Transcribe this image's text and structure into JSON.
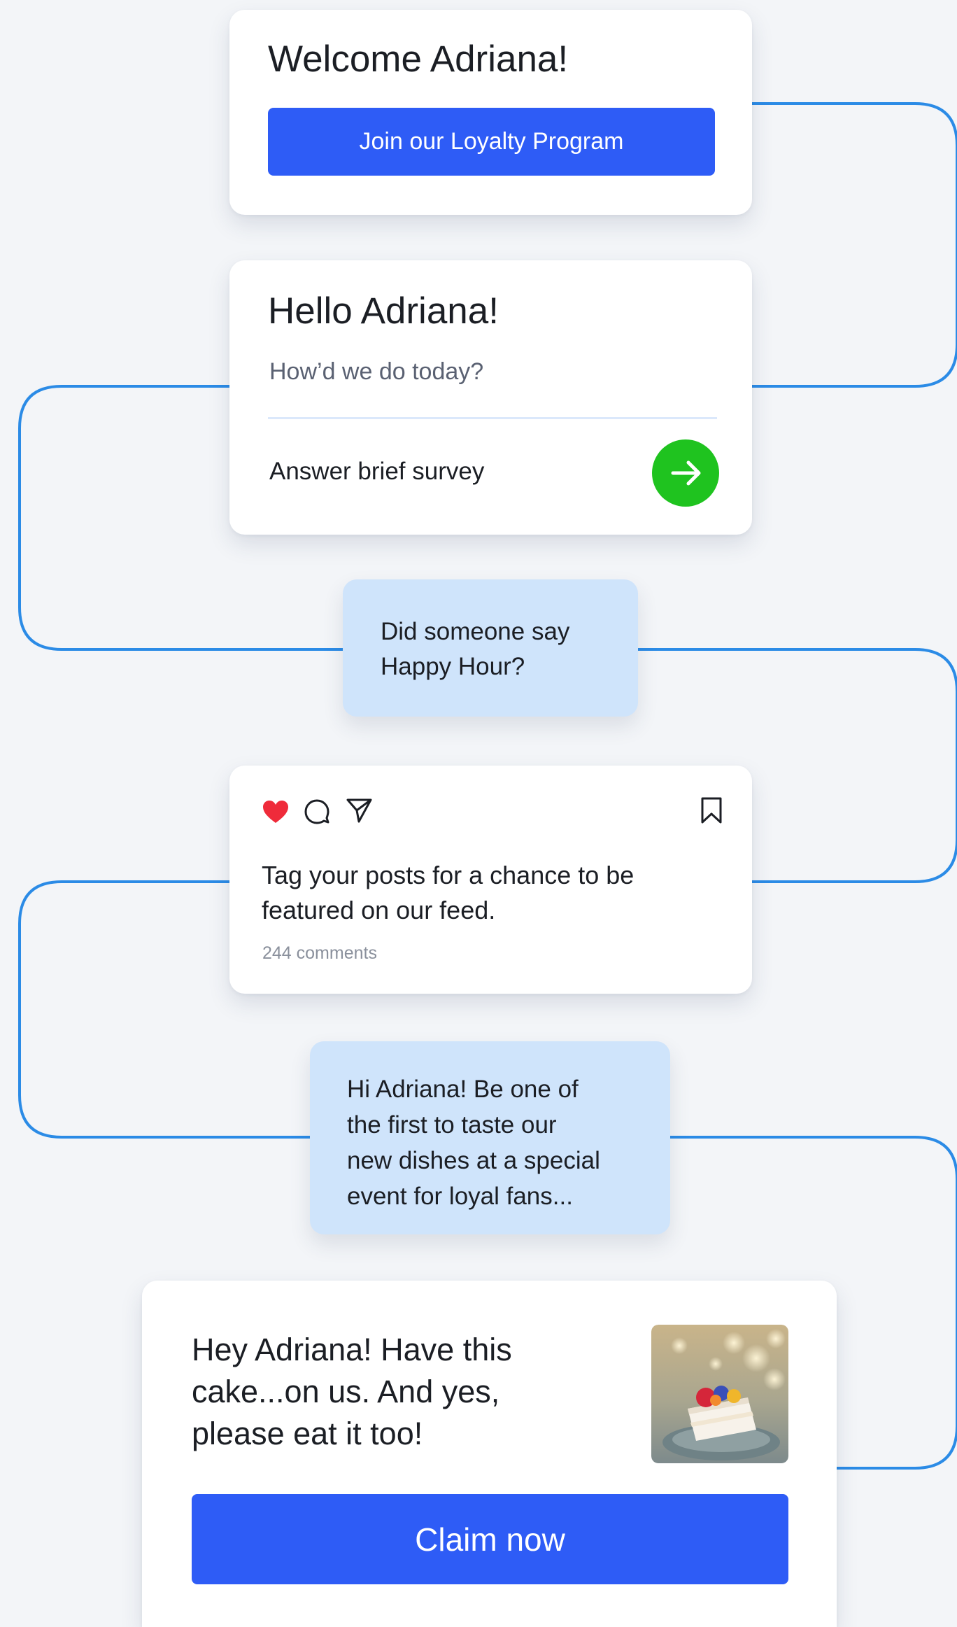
{
  "welcome_card": {
    "title": "Welcome Adriana!",
    "button_label": "Join our Loyalty Program"
  },
  "survey_card": {
    "title": "Hello Adriana!",
    "subtitle": "How’d we do today?",
    "action_label": "Answer brief survey",
    "arrow_icon": "arrow-right-icon",
    "arrow_color": "#1fc31f"
  },
  "happy_hour_bubble": {
    "line1": "Did someone say",
    "line2": "Happy Hour?"
  },
  "social_card": {
    "icons": [
      "heart-icon",
      "comment-icon",
      "send-icon",
      "bookmark-icon"
    ],
    "heart_color": "#ef2b3a",
    "caption_line1": "Tag your posts for a chance to be",
    "caption_line2": "featured on our feed.",
    "comments": "244 comments"
  },
  "event_bubble": {
    "line1": "Hi Adriana! Be one of",
    "line2": "the first to taste our",
    "line3": "new dishes at a special",
    "line4": "event for loyal fans..."
  },
  "offer_card": {
    "line1": "Hey Adriana! Have this",
    "line2": "cake...on us. And yes,",
    "line3": "please eat it too!",
    "image": "cake-photo",
    "button_label": "Claim now"
  },
  "colors": {
    "accent_blue": "#2e5cf6",
    "connector_blue": "#2b8be6",
    "bubble_bg": "#cfe4fb",
    "page_bg": "#f3f5f8"
  }
}
